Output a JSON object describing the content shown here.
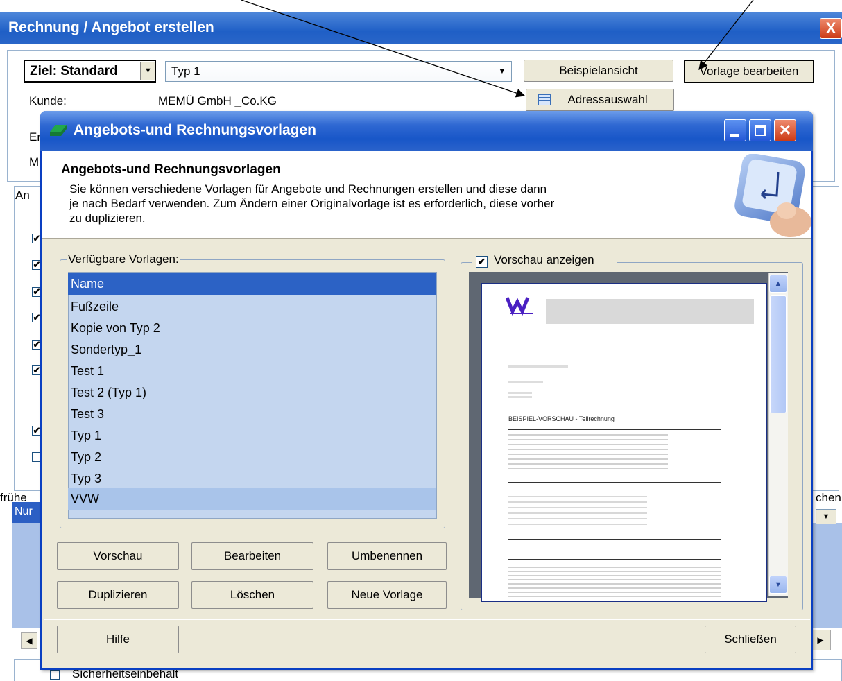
{
  "main_window": {
    "title": "Rechnung / Angebot erstellen",
    "close_glyph": "X",
    "ziel_label": "Ziel: Standard",
    "template_combo_value": "Typ 1",
    "beispielansicht_button": "Beispielansicht",
    "vorlage_bearbeiten_button": "Vorlage bearbeiten",
    "adressauswahl_button": "Adressauswahl",
    "kunde_label": "Kunde:",
    "kunde_value": "MEMÜ GmbH _Co.KG",
    "cut_labels": [
      "Er",
      "M",
      "An",
      "frühe",
      "Nur",
      "chen"
    ],
    "sicherheitseinbehalt_label": "Sicherheitseinbehalt"
  },
  "dialog": {
    "title": "Angebots-und Rechnungsvorlagen",
    "header_title": "Angebots-und Rechnungsvorlagen",
    "header_description": "Sie können verschiedene Vorlagen für Angebote und Rechnungen erstellen und diese dann je nach Bedarf verwenden. Zum Ändern einer Originalvorlage ist es erforderlich, diese vorher zu duplizieren.",
    "available_templates_label": "Verfügbare Vorlagen:",
    "templates": [
      "Name",
      "Fußzeile",
      "Kopie von Typ 2",
      "Sondertyp_1",
      "Test 1",
      "Test 2 (Typ 1)",
      "Test 3",
      "Typ 1",
      "Typ 2",
      "Typ 3",
      "VVW"
    ],
    "preview_checkbox_label": "Vorschau anzeigen",
    "buttons": {
      "vorschau": "Vorschau",
      "bearbeiten": "Bearbeiten",
      "umbenennen": "Umbenennen",
      "duplizieren": "Duplizieren",
      "loeschen": "Löschen",
      "neue_vorlage": "Neue Vorlage",
      "hilfe": "Hilfe",
      "schliessen": "Schließen"
    },
    "preview_doc": {
      "heading": "BEISPIEL-VORSCHAU - Teilrechnung"
    }
  },
  "colors": {
    "titlebar": "#2f68d2",
    "selection": "#2c62c5",
    "list_background": "#c4d6ef",
    "dialog_face": "#ece9d8"
  }
}
